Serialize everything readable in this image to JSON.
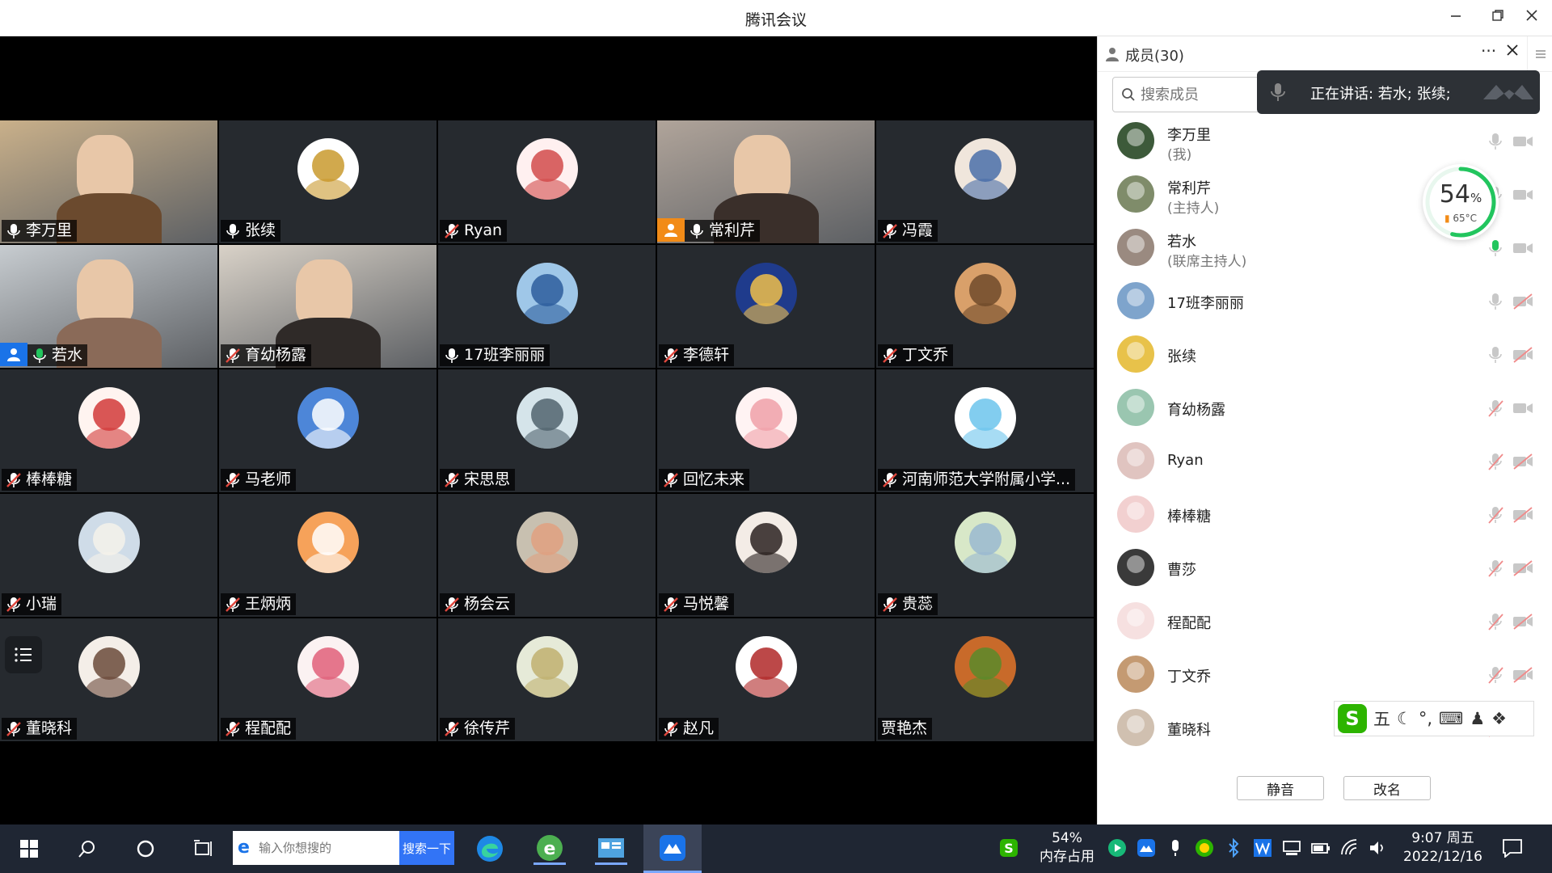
{
  "window": {
    "title": "腾讯会议",
    "controls": [
      "minimize-icon",
      "restore-icon",
      "close-icon"
    ]
  },
  "grid": {
    "tiles": [
      {
        "name": "李万里",
        "type": "video",
        "mic": "on"
      },
      {
        "name": "张续",
        "type": "avatar",
        "mic": "on"
      },
      {
        "name": "Ryan",
        "type": "avatar",
        "mic": "muted"
      },
      {
        "name": "常利芹",
        "type": "video",
        "mic": "on",
        "badge": "host"
      },
      {
        "name": "冯霞",
        "type": "avatar",
        "mic": "muted"
      },
      {
        "name": "若水",
        "type": "video",
        "mic": "speaking",
        "badge": "cohost",
        "active": true
      },
      {
        "name": "育幼杨露",
        "type": "video",
        "mic": "muted"
      },
      {
        "name": "17班李丽丽",
        "type": "avatar",
        "mic": "on"
      },
      {
        "name": "李德轩",
        "type": "avatar",
        "mic": "muted"
      },
      {
        "name": "丁文乔",
        "type": "avatar",
        "mic": "muted"
      },
      {
        "name": "棒棒糖",
        "type": "avatar",
        "mic": "muted"
      },
      {
        "name": "马老师",
        "type": "avatar",
        "mic": "muted"
      },
      {
        "name": "宋思思",
        "type": "avatar",
        "mic": "muted"
      },
      {
        "name": "回忆未来",
        "type": "avatar",
        "mic": "muted"
      },
      {
        "name": "河南师范大学附属小学...",
        "type": "avatar",
        "mic": "muted"
      },
      {
        "name": "小瑞",
        "type": "avatar",
        "mic": "muted"
      },
      {
        "name": "王炳炳",
        "type": "avatar",
        "mic": "muted"
      },
      {
        "name": "杨会云",
        "type": "avatar",
        "mic": "muted"
      },
      {
        "name": "马悦馨",
        "type": "avatar",
        "mic": "muted"
      },
      {
        "name": "贵蕊",
        "type": "avatar",
        "mic": "muted"
      },
      {
        "name": "董晓科",
        "type": "avatar",
        "mic": "muted"
      },
      {
        "name": "程配配",
        "type": "avatar",
        "mic": "muted"
      },
      {
        "name": "徐传芹",
        "type": "avatar",
        "mic": "muted"
      },
      {
        "name": "赵凡",
        "type": "avatar",
        "mic": "muted"
      },
      {
        "name": "贾艳杰",
        "type": "avatar",
        "mic": "none"
      }
    ]
  },
  "panel": {
    "title": "成员(30)",
    "search_placeholder": "搜索成员",
    "speaking_label": "正在讲话: 若水; 张续;",
    "members": [
      {
        "name": "李万里",
        "role": "(我)",
        "mic": "on",
        "cam": "on"
      },
      {
        "name": "常利芹",
        "role": "(主持人)",
        "mic": "on",
        "cam": "on"
      },
      {
        "name": "若水",
        "role": "(联席主持人)",
        "mic": "speaking",
        "cam": "on"
      },
      {
        "name": "17班李丽丽",
        "role": "",
        "mic": "on",
        "cam": "off"
      },
      {
        "name": "张续",
        "role": "",
        "mic": "on",
        "cam": "off"
      },
      {
        "name": "育幼杨露",
        "role": "",
        "mic": "off",
        "cam": "on"
      },
      {
        "name": "Ryan",
        "role": "",
        "mic": "off",
        "cam": "off"
      },
      {
        "name": "棒棒糖",
        "role": "",
        "mic": "off",
        "cam": "off"
      },
      {
        "name": "曹莎",
        "role": "",
        "mic": "off",
        "cam": "off"
      },
      {
        "name": "程配配",
        "role": "",
        "mic": "off",
        "cam": "off"
      },
      {
        "name": "丁文乔",
        "role": "",
        "mic": "off",
        "cam": "off"
      },
      {
        "name": "董晓科",
        "role": "",
        "mic": "off",
        "cam": "off"
      }
    ],
    "mute_button": "静音",
    "rename_button": "改名"
  },
  "memory_widget": {
    "percent": "54",
    "unit": "%",
    "temp": "65°C",
    "ring_color": "#22c55e",
    "fill_fraction": 0.54
  },
  "ime": {
    "logo": "S",
    "mode": "五",
    "items": [
      "moon-icon",
      "punctuation-icon",
      "keyboard-icon",
      "user-icon",
      "apps-icon"
    ]
  },
  "taskbar": {
    "search_placeholder": "输入你想搜的",
    "search_button": "搜索一下",
    "memory_percent": "54%",
    "memory_label": "内存占用",
    "time": "9:07 周五",
    "date": "2022/12/16"
  },
  "colors": {
    "accent_blue": "#1a73e8",
    "speaking_green": "#22c55e",
    "muted_red": "#e0483e",
    "host_orange": "#f28b17"
  }
}
